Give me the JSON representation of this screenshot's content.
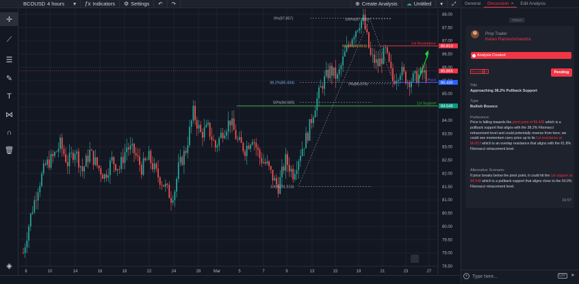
{
  "toolbar": {
    "symbol": "BCOUSD",
    "interval": "4 hours",
    "indicators": "Indicators",
    "settings": "Settings",
    "create_analysis": "Create Analysis",
    "untitled": "Untitled"
  },
  "left_tools": [
    "crosshair-icon",
    "trend-line-icon",
    "fib-icon",
    "brush-icon",
    "text-icon",
    "pattern-icon",
    "magnet-icon",
    "trash-icon",
    "layers-icon"
  ],
  "panel": {
    "tabs": [
      "General",
      "Discussion",
      "Edit Analysis"
    ],
    "active_tab": "Discussion",
    "close_glyph": "×",
    "day_chip": "TODAY",
    "role": "Prop Trader",
    "author": "Ketan Rameshchandra",
    "analysis_created": "Analysis Created",
    "symbol_chip": "BCOUSD",
    "interval_chip": "4H",
    "status": "Pending",
    "title_label": "Title",
    "title_value": "Approaching 38.2% Pullback Support",
    "type_label": "Type",
    "type_value": "Bullish Bounce",
    "preference_label": "Preference:",
    "preference_parts": [
      "Price is falling towards the ",
      "pivot point of 85.435",
      " which is a pullback support that aligns with the 38.2% Fibonacci retracement level and could potentially reverse from here; we could see momentum carry price up to its ",
      "1st resistance at 86.813",
      " which is an overlap resistance that aligns with the 61.8% Fibonacci retracement level."
    ],
    "alt_label": "Alternative Scenario:",
    "alt_parts": [
      "If price breaks below the pivot point, it could hit the ",
      "1st support at 84.548",
      " which is a pullback support that aligns close to the 50.0% Fibonacci retracement level."
    ],
    "time": "16:57",
    "composer_placeholder": "Type here...",
    "gif_label": "GIF"
  },
  "chart_data": {
    "type": "candlestick",
    "symbol": "BCOUSD",
    "interval": "4 hours",
    "ylim": [
      78.5,
      88.0
    ],
    "y_ticks": [
      78.5,
      79.0,
      79.5,
      80.0,
      80.5,
      81.0,
      81.5,
      82.0,
      82.5,
      83.0,
      83.5,
      84.0,
      84.5,
      85.0,
      85.5,
      86.0,
      86.5,
      87.0,
      87.5,
      88.0
    ],
    "x_ticks": [
      "8",
      "10",
      "14",
      "16",
      "18",
      "22",
      "24",
      "28",
      "Mar",
      "5",
      "7",
      "9",
      "13",
      "15",
      "19",
      "21",
      "23",
      "27"
    ],
    "price_tags": [
      {
        "label": "86.813",
        "value": 86.813,
        "color": "#f23645"
      },
      {
        "label": "85.866",
        "value": 85.866,
        "color": "#f23645"
      },
      {
        "label": "85.435",
        "value": 85.435,
        "color": "#2962ff"
      },
      {
        "label": "84.548",
        "value": 84.548,
        "color": "#089981"
      }
    ],
    "levels": [
      {
        "name": "1st Resistance",
        "value": 86.813,
        "color": "#f23645"
      },
      {
        "name": "Pivot",
        "value": 85.435,
        "color": "#5b5fe8"
      },
      {
        "name": "1st Support",
        "value": 84.548,
        "color": "#3ab23a"
      }
    ],
    "fib_labels": [
      {
        "text": "0%(87.857)",
        "value": 87.857
      },
      {
        "text": "100%(87.825)",
        "value": 87.825
      },
      {
        "text": "61.8%(86.813)",
        "value": 86.813
      },
      {
        "text": "38.2%(85.434)",
        "value": 85.434
      },
      {
        "text": "0%(85.376)",
        "value": 85.376
      },
      {
        "text": "50%(84.685)",
        "value": 84.685
      },
      {
        "text": "100%(81.513)",
        "value": 81.513
      }
    ],
    "path": [
      [
        0,
        79.0
      ],
      [
        4,
        80.4
      ],
      [
        8,
        81.5
      ],
      [
        12,
        82.3
      ],
      [
        16,
        82.6
      ],
      [
        20,
        83.1
      ],
      [
        24,
        82.4
      ],
      [
        28,
        82.9
      ],
      [
        32,
        82.1
      ],
      [
        36,
        82.8
      ],
      [
        40,
        82.3
      ],
      [
        44,
        81.9
      ],
      [
        48,
        82.5
      ],
      [
        52,
        82.2
      ],
      [
        56,
        83.0
      ],
      [
        60,
        82.8
      ],
      [
        64,
        82.2
      ],
      [
        68,
        82.6
      ],
      [
        72,
        82.0
      ],
      [
        76,
        81.6
      ],
      [
        80,
        81.1
      ],
      [
        82,
        81.4
      ],
      [
        84,
        82.2
      ],
      [
        88,
        82.9
      ],
      [
        92,
        84.3
      ],
      [
        96,
        83.5
      ],
      [
        100,
        83.7
      ],
      [
        104,
        83.0
      ],
      [
        108,
        83.6
      ],
      [
        112,
        84.0
      ],
      [
        116,
        83.2
      ],
      [
        120,
        82.9
      ],
      [
        124,
        83.4
      ],
      [
        128,
        82.6
      ],
      [
        132,
        82.3
      ],
      [
        136,
        81.7
      ],
      [
        138,
        81.5
      ],
      [
        142,
        82.5
      ],
      [
        146,
        82.0
      ],
      [
        150,
        82.8
      ],
      [
        154,
        83.5
      ],
      [
        158,
        84.6
      ],
      [
        162,
        85.4
      ],
      [
        166,
        85.9
      ],
      [
        170,
        85.6
      ],
      [
        174,
        86.5
      ],
      [
        178,
        87.2
      ],
      [
        182,
        87.7
      ],
      [
        184,
        87.8
      ],
      [
        188,
        86.4
      ],
      [
        192,
        86.1
      ],
      [
        196,
        86.6
      ],
      [
        200,
        85.5
      ],
      [
        204,
        85.9
      ],
      [
        208,
        85.5
      ],
      [
        212,
        85.6
      ],
      [
        216,
        85.8
      ],
      [
        218,
        85.7
      ]
    ]
  }
}
